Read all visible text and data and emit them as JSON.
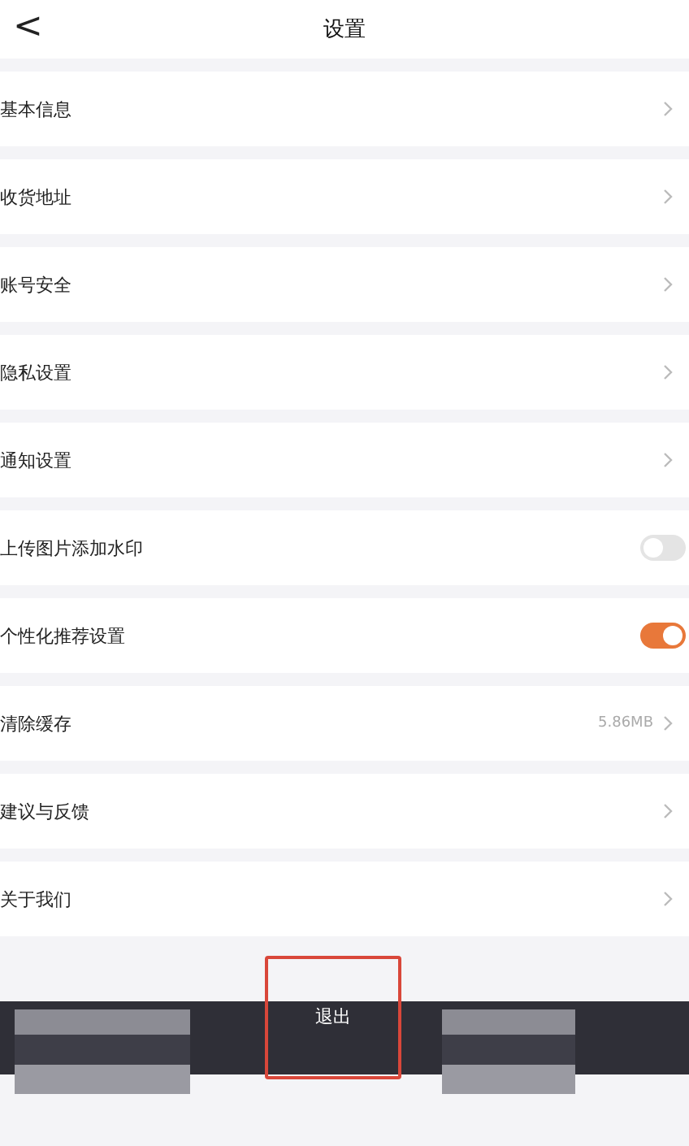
{
  "header": {
    "back": "<",
    "title": "设置"
  },
  "items": [
    {
      "kind": "link",
      "label": "基本信息"
    },
    {
      "kind": "link",
      "label": "收货地址"
    },
    {
      "kind": "link",
      "label": "账号安全"
    },
    {
      "kind": "link",
      "label": "隐私设置"
    },
    {
      "kind": "link",
      "label": "通知设置"
    },
    {
      "kind": "toggle",
      "label": "上传图片添加水印",
      "on": false
    },
    {
      "kind": "toggle",
      "label": "个性化推荐设置",
      "on": true
    },
    {
      "kind": "value",
      "label": "清除缓存",
      "value": "5.86MB"
    },
    {
      "kind": "link",
      "label": "建议与反馈"
    },
    {
      "kind": "link",
      "label": "关于我们"
    }
  ],
  "footer": {
    "logout": "退出",
    "highlighted": true
  }
}
